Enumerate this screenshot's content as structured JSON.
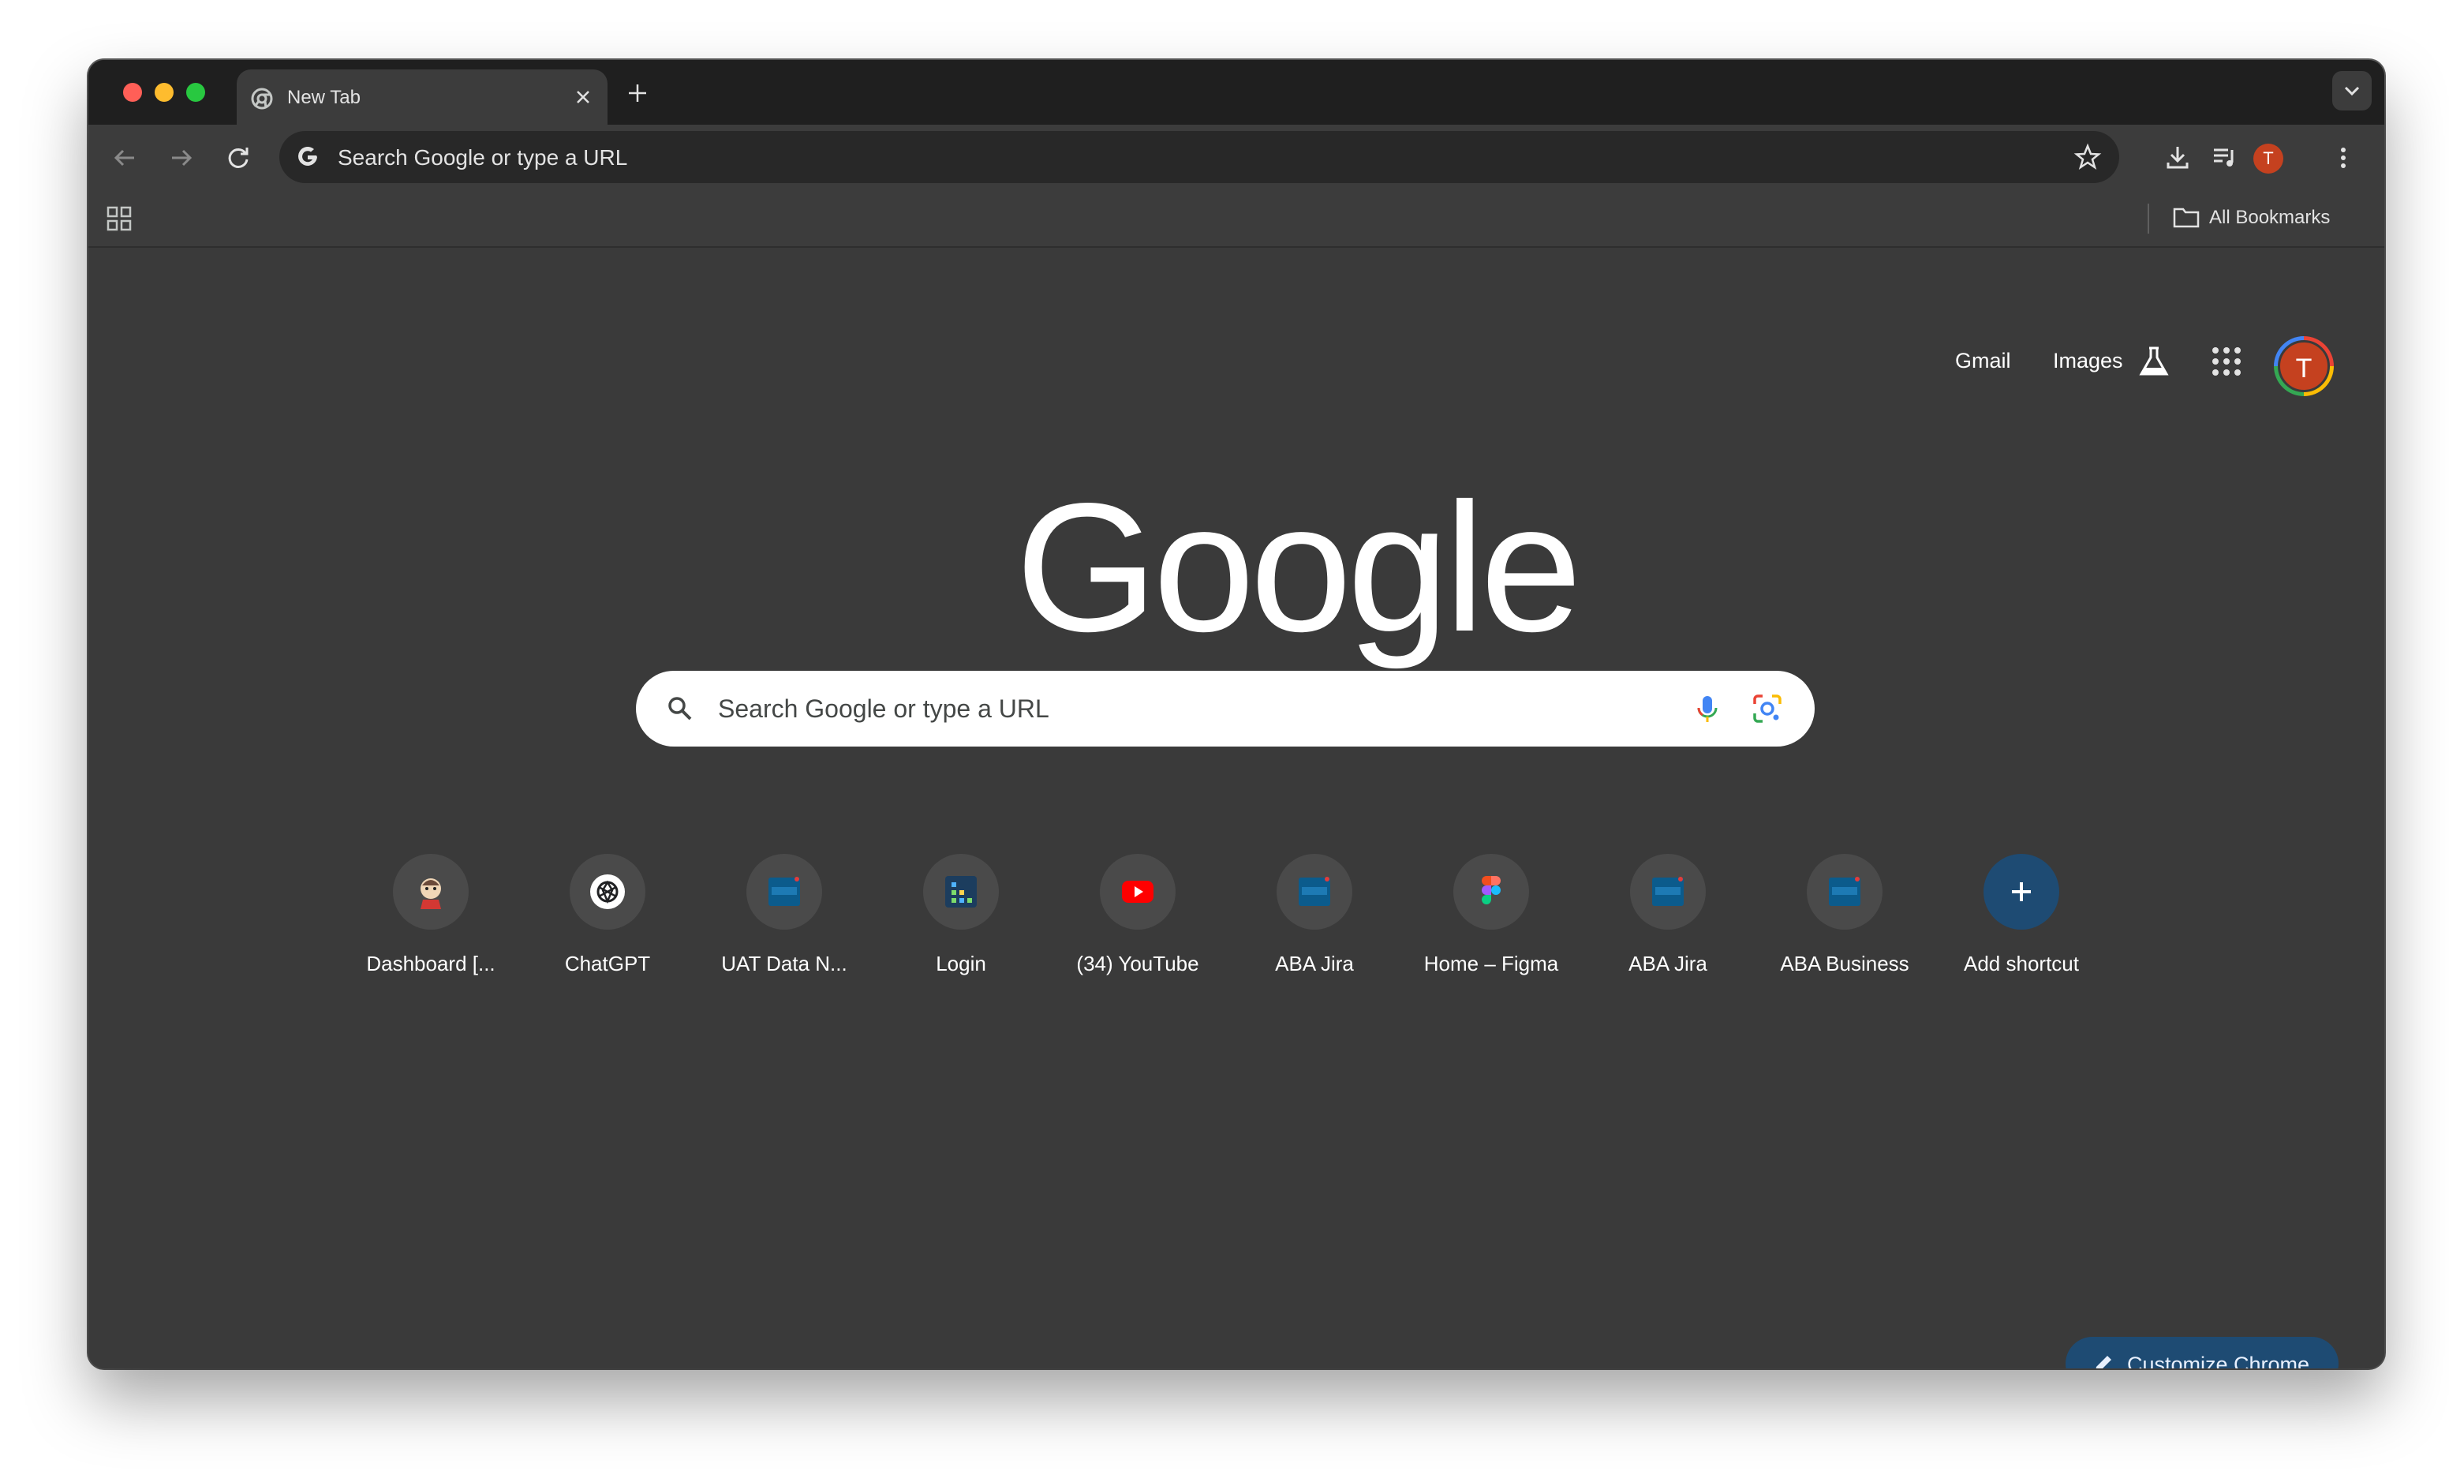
{
  "window_controls": {
    "close_color": "#ff5f57",
    "minimize_color": "#febc2e",
    "maximize_color": "#28c840"
  },
  "tab": {
    "title": "New Tab",
    "favicon": "chrome-icon"
  },
  "toolbar": {
    "omnibox_placeholder": "Search Google or type a URL",
    "profile_initial": "T"
  },
  "bookmarks_bar": {
    "all_bookmarks_label": "All Bookmarks"
  },
  "ntp": {
    "links": {
      "gmail": "Gmail",
      "images": "Images"
    },
    "avatar_initial": "T",
    "logo_text": "Google",
    "search_placeholder": "Search Google or type a URL",
    "shortcuts": [
      {
        "label": "Dashboard [...",
        "icon": "jenkins-icon"
      },
      {
        "label": "ChatGPT",
        "icon": "openai-icon"
      },
      {
        "label": "UAT Data N...",
        "icon": "aba-bank-icon"
      },
      {
        "label": "Login",
        "icon": "login-app-icon"
      },
      {
        "label": "(34) YouTube",
        "icon": "youtube-icon"
      },
      {
        "label": "ABA Jira",
        "icon": "aba-bank-icon"
      },
      {
        "label": "Home – Figma",
        "icon": "figma-icon"
      },
      {
        "label": "ABA Jira",
        "icon": "aba-bank-icon"
      },
      {
        "label": "ABA Business",
        "icon": "aba-bank-icon"
      },
      {
        "label": "Add shortcut",
        "icon": "plus-icon"
      }
    ],
    "customize_label": "Customize Chrome"
  },
  "colors": {
    "chrome_frame": "#1f1f1f",
    "toolbar": "#3c3c3c",
    "page_background": "#3a3a3a",
    "accent_blue": "#1e4b73",
    "avatar": "#c5411f"
  }
}
